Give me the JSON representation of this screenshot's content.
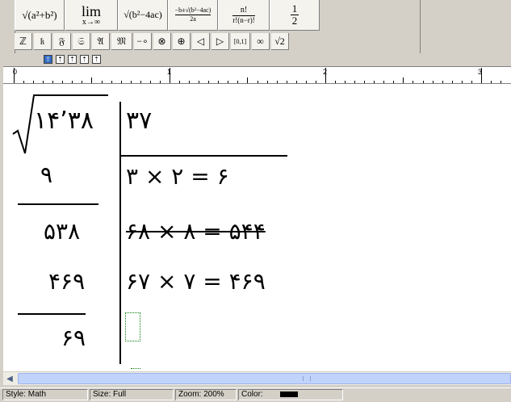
{
  "toolbar": {
    "templates": [
      "√(a²+b²)",
      "lim",
      "x→∞",
      "√(b²−4ac)",
      "−b±√(b²−4ac)",
      "2a",
      "n!",
      "r!(n−r)!",
      "1",
      "2"
    ],
    "symbols": [
      "ℤ",
      "𝔨",
      "𝔉",
      "𝔖",
      "𝔄",
      "𝔐",
      "−∘",
      "⊗",
      "⊕",
      "◁",
      "▷",
      "[0,1]",
      "∞",
      "√2"
    ],
    "nudge": [
      "⇧",
      "⇡",
      "⇡",
      "⇡",
      "⇡"
    ]
  },
  "ruler": {
    "marks": [
      "0",
      "1",
      "2",
      "3"
    ]
  },
  "document": {
    "radicand": "۱۴٬۳۸",
    "root": "۳۷",
    "left_rows": [
      "۹",
      "۵۳۸",
      "۴۶۹",
      "۶۹"
    ],
    "right_rows": [
      "۳ × ۲ = ۶",
      "۶۸ × ۸ = ۵۴۴",
      "۶۷ × ۷ = ۴۶۹"
    ]
  },
  "status": {
    "style": "Style: Math",
    "size": "Size: Full",
    "zoom": "Zoom: 200%",
    "color_label": "Color:",
    "color_value": "#000000"
  }
}
